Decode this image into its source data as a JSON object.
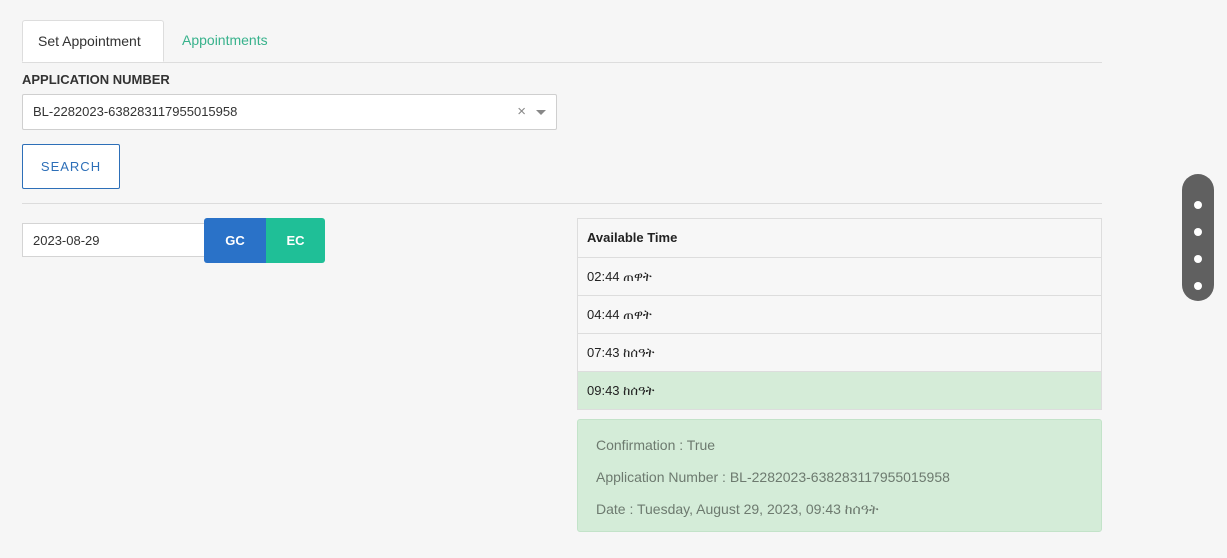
{
  "tabs": [
    {
      "label": "Set Appointment",
      "active": true
    },
    {
      "label": "Appointments",
      "active": false
    }
  ],
  "form": {
    "application_label": "APPLICATION NUMBER",
    "application_value": "BL-2282023-638283117955015958",
    "clear_glyph": "×",
    "search_label": "SEARCH",
    "date_value": "2023-08-29",
    "gc_label": "GC",
    "ec_label": "EC"
  },
  "times": {
    "header": "Available Time",
    "rows": [
      "02:44 ጠዋት",
      "04:44 ጠዋት",
      "07:43 ከሰዓት",
      "09:43 ከሰዓት"
    ],
    "selected_index": 3
  },
  "confirmation": {
    "line1": "Confirmation : True",
    "line2": "Application Number : BL-2282023-638283117955015958",
    "line3": "Date : Tuesday, August 29, 2023, 09:43 ከሰዓት"
  },
  "colors": {
    "accent_green": "#38b28c",
    "gc_blue": "#2a72c8",
    "ec_teal": "#1fbf97",
    "selected_row": "#d5ecd8"
  }
}
